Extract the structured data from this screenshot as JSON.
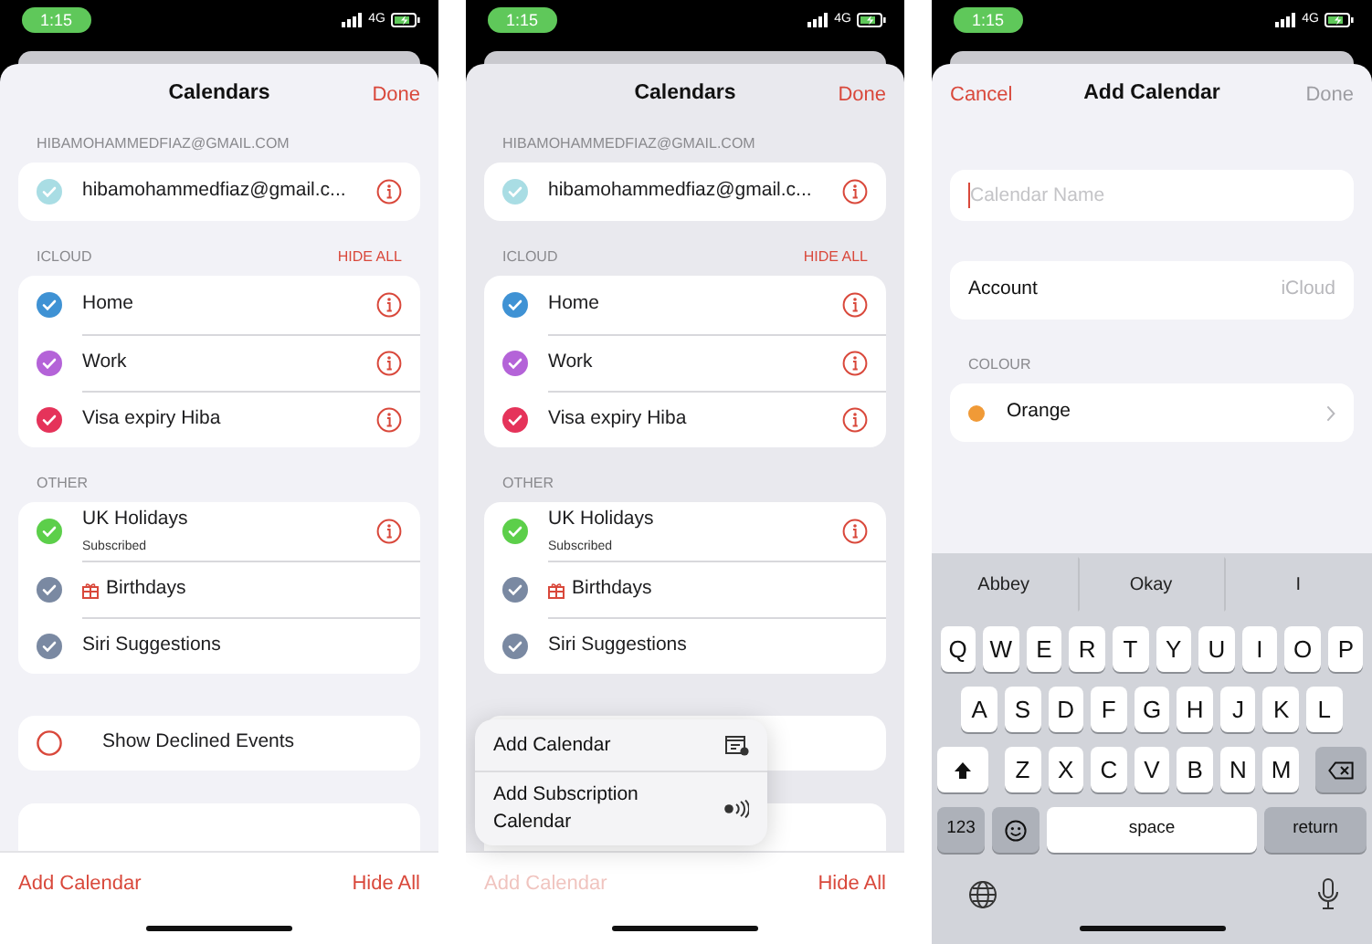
{
  "screens": [
    {
      "kind": "list",
      "status": {
        "time": "1:15",
        "network": "4G"
      },
      "title": "Calendars",
      "done": "Done",
      "sections": [
        {
          "header": "HIBAMOHAMMEDFIAZ@GMAIL.COM",
          "items": [
            {
              "kind": "calendar",
              "name": "hibamohammedfiaz@gmail.c...",
              "color": "#a9dde4",
              "checked": true,
              "info": true
            }
          ]
        },
        {
          "header": "ICLOUD",
          "action": "HIDE ALL",
          "items": [
            {
              "kind": "calendar",
              "name": "Home",
              "color": "#3f92d4",
              "checked": true,
              "info": true
            },
            {
              "kind": "calendar",
              "name": "Work",
              "color": "#b463d8",
              "checked": true,
              "info": true
            },
            {
              "kind": "calendar",
              "name": "Visa expiry Hiba",
              "color": "#e5335a",
              "checked": true,
              "info": true
            }
          ]
        },
        {
          "header": "OTHER",
          "items": [
            {
              "kind": "calendar",
              "name": "UK Holidays",
              "subtitle": "Subscribed",
              "color": "#5ccf4a",
              "checked": true,
              "info": true
            },
            {
              "kind": "birthdays",
              "name": "Birthdays",
              "color": "#7a89a2",
              "checked": true,
              "info": false
            },
            {
              "kind": "calendar",
              "name": "Siri Suggestions",
              "color": "#7a89a2",
              "checked": true,
              "info": false
            }
          ]
        }
      ],
      "options": [
        {
          "label": "Show Declined Events",
          "checked": false
        }
      ],
      "footer": {
        "add": "Add Calendar",
        "add_disabled": false,
        "hide": "Hide All"
      }
    },
    {
      "kind": "list",
      "status": {
        "time": "1:15",
        "network": "4G"
      },
      "title": "Calendars",
      "done": "Done",
      "sections": [
        {
          "header": "HIBAMOHAMMEDFIAZ@GMAIL.COM",
          "items": [
            {
              "kind": "calendar",
              "name": "hibamohammedfiaz@gmail.c...",
              "color": "#a9dde4",
              "checked": true,
              "info": true
            }
          ]
        },
        {
          "header": "ICLOUD",
          "action": "HIDE ALL",
          "items": [
            {
              "kind": "calendar",
              "name": "Home",
              "color": "#3f92d4",
              "checked": true,
              "info": true
            },
            {
              "kind": "calendar",
              "name": "Work",
              "color": "#b463d8",
              "checked": true,
              "info": true
            },
            {
              "kind": "calendar",
              "name": "Visa expiry Hiba",
              "color": "#e5335a",
              "checked": true,
              "info": true
            }
          ]
        },
        {
          "header": "OTHER",
          "items": [
            {
              "kind": "calendar",
              "name": "UK Holidays",
              "subtitle": "Subscribed",
              "color": "#5ccf4a",
              "checked": true,
              "info": true
            },
            {
              "kind": "birthdays",
              "name": "Birthdays",
              "color": "#7a89a2",
              "checked": true,
              "info": false
            },
            {
              "kind": "calendar",
              "name": "Siri Suggestions",
              "color": "#7a89a2",
              "checked": true,
              "info": false
            }
          ]
        }
      ],
      "menu": [
        {
          "kind": "calendar",
          "label": "Add Calendar"
        },
        {
          "kind": "subscription",
          "label": "Add Subscription Calendar"
        }
      ],
      "footer": {
        "add": "Add Calendar",
        "add_disabled": true,
        "hide": "Hide All"
      }
    },
    {
      "kind": "form",
      "status": {
        "time": "1:15",
        "network": "4G"
      },
      "cancel": "Cancel",
      "title": "Add Calendar",
      "done": "Done",
      "done_disabled": true,
      "name_field": {
        "placeholder": "Calendar Name"
      },
      "account": {
        "label": "Account",
        "value": "iCloud"
      },
      "colour_header": "COLOUR",
      "colour": {
        "name": "Orange",
        "color": "#f09a37"
      },
      "keyboard": {
        "suggestions": [
          "Abbey",
          "Okay",
          "I"
        ],
        "rows": [
          [
            "Q",
            "W",
            "E",
            "R",
            "T",
            "Y",
            "U",
            "I",
            "O",
            "P"
          ],
          [
            "A",
            "S",
            "D",
            "F",
            "G",
            "H",
            "J",
            "K",
            "L"
          ],
          [
            "Z",
            "X",
            "C",
            "V",
            "B",
            "N",
            "M"
          ]
        ],
        "numbers": "123",
        "space": "space",
        "return": "return"
      }
    }
  ]
}
